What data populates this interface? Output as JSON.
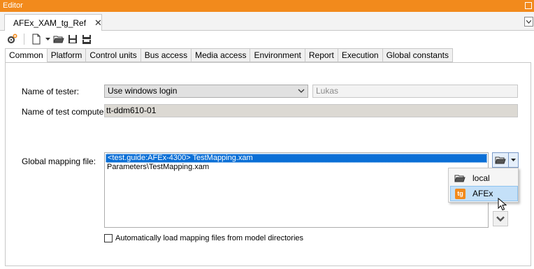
{
  "window": {
    "title": "Editor"
  },
  "document_tab": {
    "label": "AFEx_XAM_tg_Ref",
    "close": "✕"
  },
  "toolbar": {
    "icons": [
      "gear-icon",
      "new-file-icon",
      "open-folder-icon",
      "save-icon",
      "save-all-icon"
    ]
  },
  "tabs": [
    {
      "label": "Common",
      "active": true
    },
    {
      "label": "Platform"
    },
    {
      "label": "Control units"
    },
    {
      "label": "Bus access"
    },
    {
      "label": "Media access"
    },
    {
      "label": "Environment"
    },
    {
      "label": "Report"
    },
    {
      "label": "Execution"
    },
    {
      "label": "Global constants"
    }
  ],
  "form": {
    "tester_label": "Name of tester:",
    "tester_mode": "Use windows login",
    "tester_name": "Lukas",
    "computer_label": "Name of test computer:",
    "computer_value": "tt-ddm610-01",
    "mapping_label": "Global mapping file:",
    "mapping_items": [
      "<test.guide:AFEx-4300> TestMapping.xam",
      "Parameters\\TestMapping.xam"
    ],
    "auto_load_label": "Automatically load mapping files from model directories",
    "auto_load_checked": false
  },
  "popup_menu": {
    "items": [
      {
        "label": "local",
        "icon": "folder-icon"
      },
      {
        "label": "AFEx",
        "icon": "tg-icon",
        "badge": "tg",
        "highlighted": true
      }
    ]
  },
  "colors": {
    "title_bar": "#f28a1c",
    "selection": "#0a6fd6",
    "menu_highlight": "#c4e0f8"
  }
}
